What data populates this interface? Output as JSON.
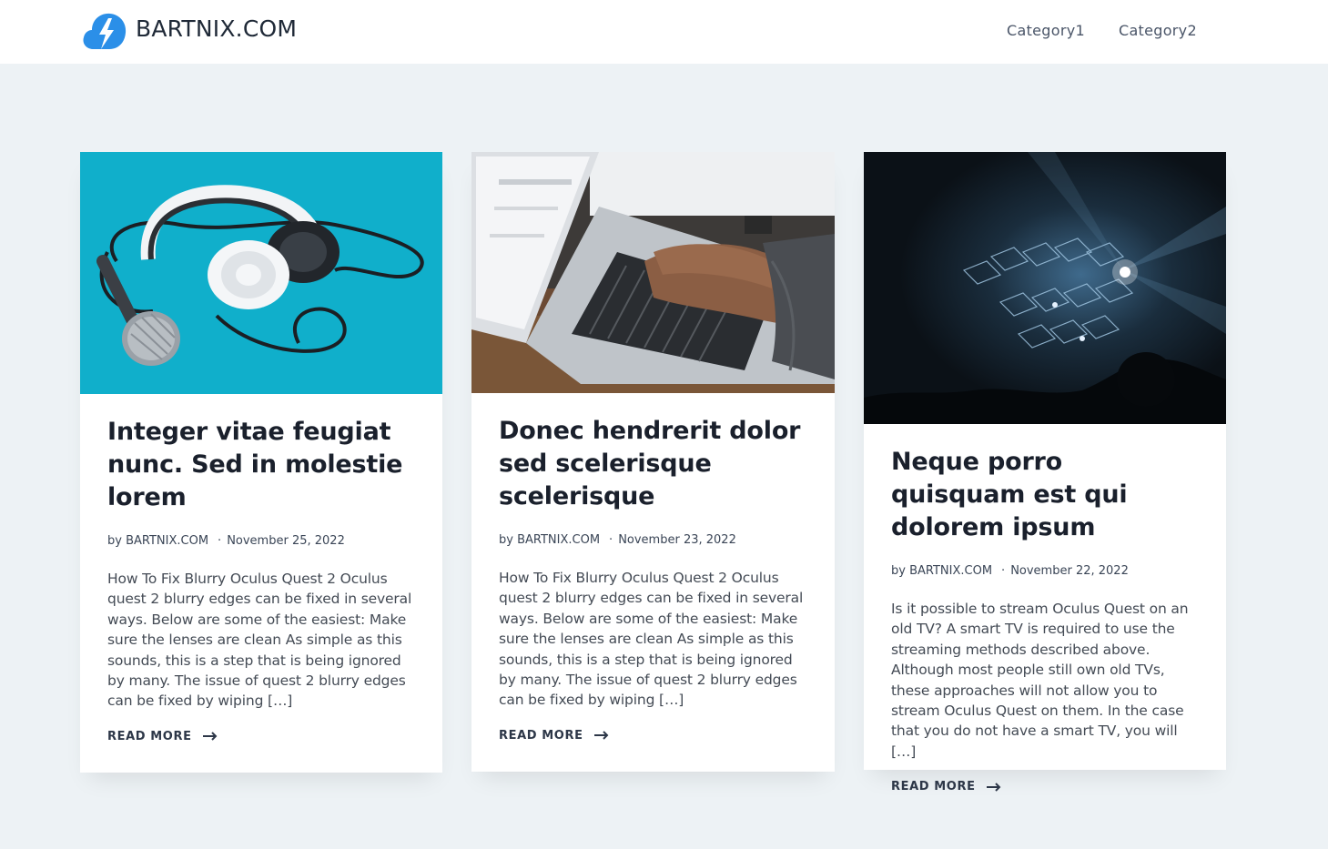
{
  "site": {
    "name": "BARTNIX.COM"
  },
  "nav": {
    "items": [
      {
        "label": "Category1"
      },
      {
        "label": "Category2"
      }
    ]
  },
  "posts": [
    {
      "title": "Integer vitae feugiat nunc. Sed in molestie lorem",
      "author": "by BARTNIX.COM",
      "separator": "·",
      "date": "November 25, 2022",
      "excerpt": "How To Fix Blurry Oculus Quest 2 Oculus quest 2 blurry edges can be fixed in several ways. Below are some of the easiest: Make sure the lenses are clean As simple as this sounds, this is a step that is being ignored by many. The issue of quest 2 blurry edges can be fixed by wiping […]",
      "read_more": "READ MORE",
      "image": "headphones-microphone-image"
    },
    {
      "title": "Donec hendrerit dolor sed scelerisque scelerisque",
      "author": "by BARTNIX.COM",
      "separator": "·",
      "date": "November 23, 2022",
      "excerpt": "How To Fix Blurry Oculus Quest 2 Oculus quest 2 blurry edges can be fixed in several ways. Below are some of the easiest: Make sure the lenses are clean As simple as this sounds, this is a step that is being ignored by many. The issue of quest 2 blurry edges can be fixed by wiping […]",
      "read_more": "READ MORE",
      "image": "laptop-typing-image"
    },
    {
      "title": "Neque porro quisquam est qui dolorem ipsum",
      "author": "by BARTNIX.COM",
      "separator": "·",
      "date": "November 22, 2022",
      "excerpt": "Is it possible to stream Oculus Quest on an old TV? A smart TV is required to use the streaming methods described above. Although most people still own old TVs, these approaches will not allow you to stream Oculus Quest on them. In the case that you do not have a smart TV, you will […]",
      "read_more": "READ MORE",
      "image": "concert-lights-image"
    }
  ],
  "colors": {
    "page_background": "#edf2f5",
    "logo_blue": "#2b8fe8",
    "title": "#1a202c",
    "text": "#444b55"
  }
}
